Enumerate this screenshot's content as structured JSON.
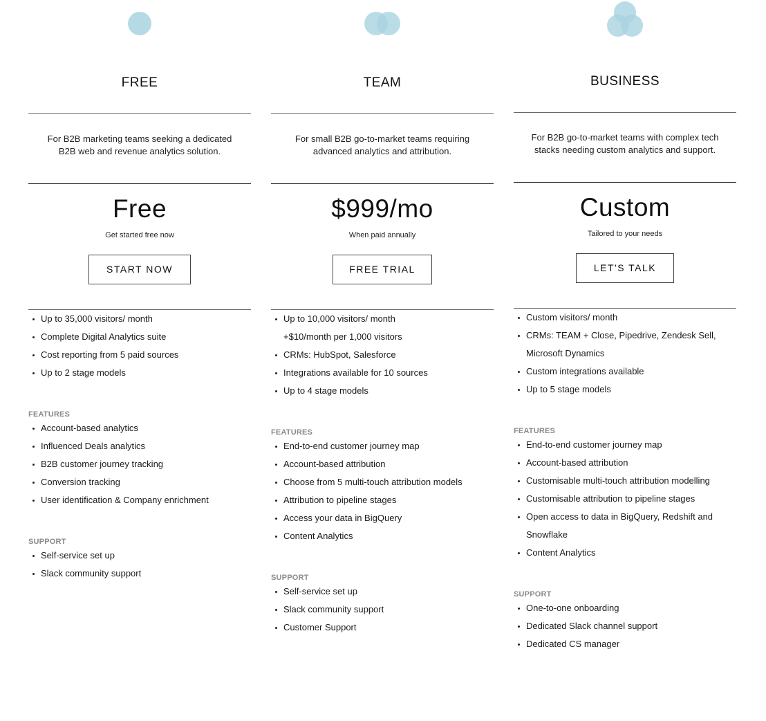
{
  "theme": {
    "accent": "#a9d3e0",
    "accent_overlap": "#7fb3c6",
    "rule": "#666666",
    "muted": "#8a8a8a"
  },
  "plans": [
    {
      "id": "free",
      "icon": "single-circle-icon",
      "name": "FREE",
      "description": "For B2B marketing teams seeking a dedicated B2B web and revenue analytics solution.",
      "price": "Free",
      "price_note": "Get started free now",
      "cta": "START NOW",
      "limits": [
        {
          "text": "Up to 35,000 visitors/ month",
          "bullet": true
        },
        {
          "text": "Complete Digital Analytics suite",
          "bullet": true
        },
        {
          "text": "Cost reporting from 5 paid sources",
          "bullet": true
        },
        {
          "text": "Up to 2 stage models",
          "bullet": true
        }
      ],
      "features_label": "FEATURES",
      "features": [
        {
          "text": "Account-based analytics",
          "bullet": true
        },
        {
          "text": "Influenced Deals analytics",
          "bullet": true
        },
        {
          "text": "B2B customer journey tracking",
          "bullet": true
        },
        {
          "text": "Conversion tracking",
          "bullet": true
        },
        {
          "text": "User identification & Company enrichment",
          "bullet": true
        }
      ],
      "support_label": "SUPPORT",
      "support": [
        {
          "text": "Self-service set up",
          "bullet": true
        },
        {
          "text": "Slack community support",
          "bullet": true
        }
      ]
    },
    {
      "id": "team",
      "icon": "two-circles-icon",
      "name": "TEAM",
      "description": "For small B2B go-to-market teams requiring advanced analytics and attribution.",
      "price": "$999/mo",
      "price_note": "When paid annually",
      "cta": "FREE TRIAL",
      "limits": [
        {
          "text": "Up to 10,000 visitors/ month",
          "bullet": true
        },
        {
          "text": "+$10/month per 1,000 visitors",
          "bullet": false
        },
        {
          "text": "CRMs: HubSpot, Salesforce",
          "bullet": true
        },
        {
          "text": "Integrations available for 10 sources",
          "bullet": true
        },
        {
          "text": "Up to 4 stage models",
          "bullet": true
        }
      ],
      "features_label": "FEATURES",
      "features": [
        {
          "text": "End-to-end customer journey map",
          "bullet": true
        },
        {
          "text": "Account-based attribution",
          "bullet": true
        },
        {
          "text": "Choose from 5 multi-touch attribution models",
          "bullet": true
        },
        {
          "text": "Attribution to pipeline stages",
          "bullet": true
        },
        {
          "text": "Access your data in BigQuery",
          "bullet": true
        },
        {
          "text": "Content Analytics",
          "bullet": true
        }
      ],
      "support_label": "SUPPORT",
      "support": [
        {
          "text": "Self-service set up",
          "bullet": true
        },
        {
          "text": "Slack community support",
          "bullet": true
        },
        {
          "text": "Customer Support",
          "bullet": true
        }
      ]
    },
    {
      "id": "business",
      "icon": "three-circles-icon",
      "name": "BUSINESS",
      "description": "For B2B go-to-market teams with complex tech stacks needing custom analytics and support.",
      "price": "Custom",
      "price_note": "Tailored to your needs",
      "cta": "LET'S TALK",
      "limits": [
        {
          "text": "Custom visitors/ month",
          "bullet": true
        },
        {
          "text": "CRMs: TEAM + Close, Pipedrive, Zendesk Sell,",
          "bullet": true
        },
        {
          "text": "Microsoft Dynamics",
          "bullet": false
        },
        {
          "text": "Custom integrations available",
          "bullet": true
        },
        {
          "text": "Up to 5 stage models",
          "bullet": true
        }
      ],
      "features_label": "FEATURES",
      "features": [
        {
          "text": "End-to-end customer journey map",
          "bullet": true
        },
        {
          "text": "Account-based attribution",
          "bullet": true
        },
        {
          "text": "Customisable multi-touch attribution modelling",
          "bullet": true
        },
        {
          "text": "Customisable attribution to pipeline stages",
          "bullet": true
        },
        {
          "text": "Open access to data in BigQuery, Redshift and",
          "bullet": true
        },
        {
          "text": "Snowflake",
          "bullet": false
        },
        {
          "text": "Content Analytics",
          "bullet": true
        }
      ],
      "support_label": "SUPPORT",
      "support": [
        {
          "text": "One-to-one onboarding",
          "bullet": true
        },
        {
          "text": "Dedicated Slack channel support",
          "bullet": true
        },
        {
          "text": "Dedicated CS manager",
          "bullet": true
        }
      ]
    }
  ]
}
